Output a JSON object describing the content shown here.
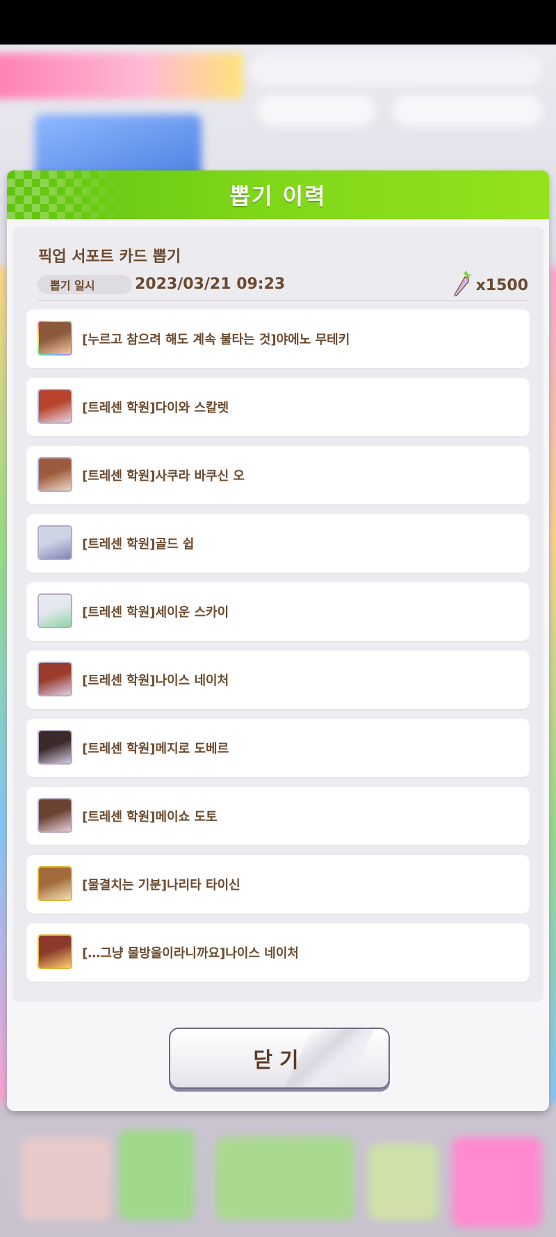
{
  "dialog": {
    "title": "뽑기 이력",
    "gacha_name": "픽업 서포트 카드 뽑기",
    "date_label": "뽑기 일시",
    "date_value": "2023/03/21 09:23",
    "cost_icon": "carrot-jewel-icon",
    "cost_value": "x1500",
    "close_label": "닫기"
  },
  "items": [
    {
      "name": "[누르고 참으려 해도 계속 불타는 것]야에노 무테키",
      "frame": "rainbow",
      "art_colors": [
        "#8b5a3c",
        "#f4c6a4"
      ]
    },
    {
      "name": "[트레센 학원]다이와 스칼렛",
      "frame": "silver",
      "art_colors": [
        "#b8442c",
        "#e9d4df"
      ]
    },
    {
      "name": "[트레센 학원]사쿠라 바쿠신 오",
      "frame": "silver",
      "art_colors": [
        "#9c5b3c",
        "#f0d7c7"
      ]
    },
    {
      "name": "[트레센 학원]골드 쉽",
      "frame": "silver",
      "art_colors": [
        "#cfd3e6",
        "#7f86b8"
      ]
    },
    {
      "name": "[트레센 학원]세이운 스카이",
      "frame": "silver",
      "art_colors": [
        "#e6e8ef",
        "#8fd3a6"
      ]
    },
    {
      "name": "[트레센 학원]나이스 네이처",
      "frame": "silver",
      "art_colors": [
        "#9b3b2c",
        "#d9cfe6"
      ]
    },
    {
      "name": "[트레센 학원]메지로 도베르",
      "frame": "silver",
      "art_colors": [
        "#3b2a2a",
        "#d2c8e3"
      ]
    },
    {
      "name": "[트레센 학원]메이쇼 도토",
      "frame": "silver",
      "art_colors": [
        "#6b4132",
        "#e6d0dc"
      ]
    },
    {
      "name": "[물결치는 기분]나리타 타이신",
      "frame": "gold",
      "art_colors": [
        "#a36b3b",
        "#f3e0b6"
      ]
    },
    {
      "name": "[…그냥 물방울이라니까요]나이스 네이처",
      "frame": "gold",
      "art_colors": [
        "#8b3a2c",
        "#ffcf70"
      ]
    }
  ]
}
